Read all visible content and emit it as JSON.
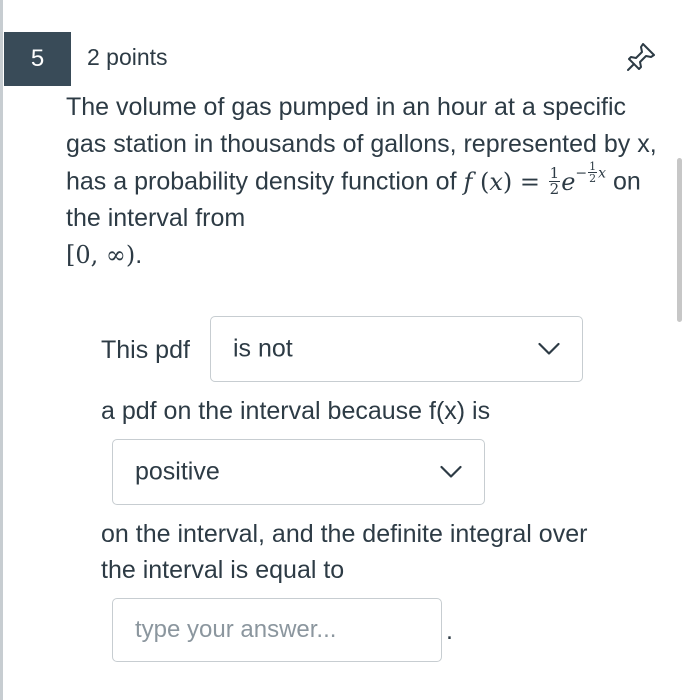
{
  "question": {
    "number": "5",
    "points": "2 points",
    "text_part1": "The volume of gas pumped in an hour at a specific gas station in thousands of gallons, represented by x, has a probability density function of ",
    "math_f": "f",
    "math_open_paren": "(",
    "math_x": "x",
    "math_close_eq": ") =",
    "frac_num": "1",
    "frac_den": "2",
    "math_e": "e",
    "exp_minus": "−",
    "exp_frac_num": "1",
    "exp_frac_den": "2",
    "exp_x": "x",
    "text_part2": " on the interval from",
    "interval": "[0, ∞)",
    "interval_end": "."
  },
  "dropdown1": {
    "prefix_label": "This pdf",
    "selected": "is not"
  },
  "sentence2": "a pdf on the interval because f(x) is",
  "dropdown2": {
    "selected": "positive"
  },
  "sentence3": "on the interval, and the definite integral over the interval is equal to",
  "answer": {
    "placeholder": "type your answer...",
    "value": "",
    "suffix": "."
  }
}
